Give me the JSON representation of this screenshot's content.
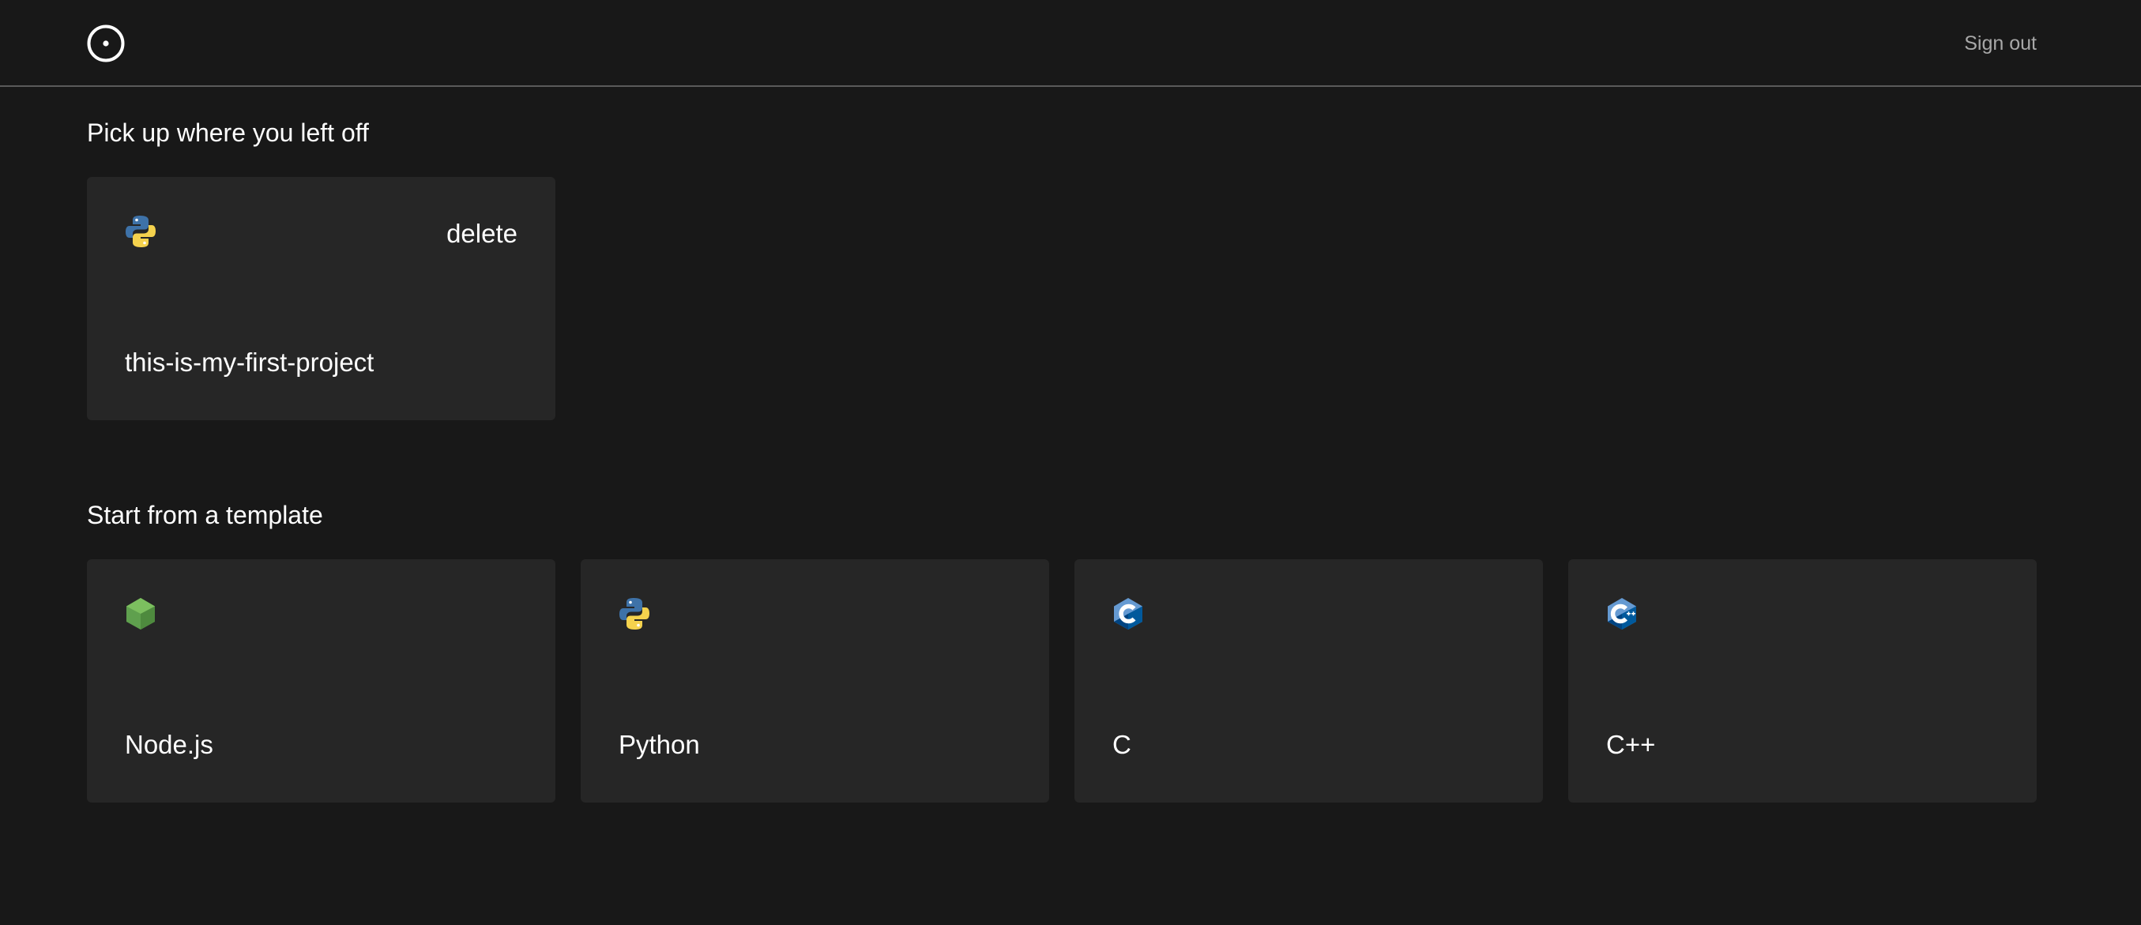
{
  "header": {
    "logo_icon": "circle-dot-icon",
    "sign_out_label": "Sign out"
  },
  "recent": {
    "title": "Pick up where you left off",
    "projects": [
      {
        "name": "this-is-my-first-project",
        "icon": "python-icon",
        "delete_label": "delete"
      }
    ]
  },
  "templates": {
    "title": "Start from a template",
    "items": [
      {
        "label": "Node.js",
        "icon": "nodejs-icon"
      },
      {
        "label": "Python",
        "icon": "python-icon"
      },
      {
        "label": "C",
        "icon": "c-icon"
      },
      {
        "label": "C++",
        "icon": "cpp-icon"
      }
    ]
  },
  "colors": {
    "background": "#181818",
    "card": "#262626",
    "muted_text": "#a8a8a8",
    "divider": "#5a5a5a"
  }
}
